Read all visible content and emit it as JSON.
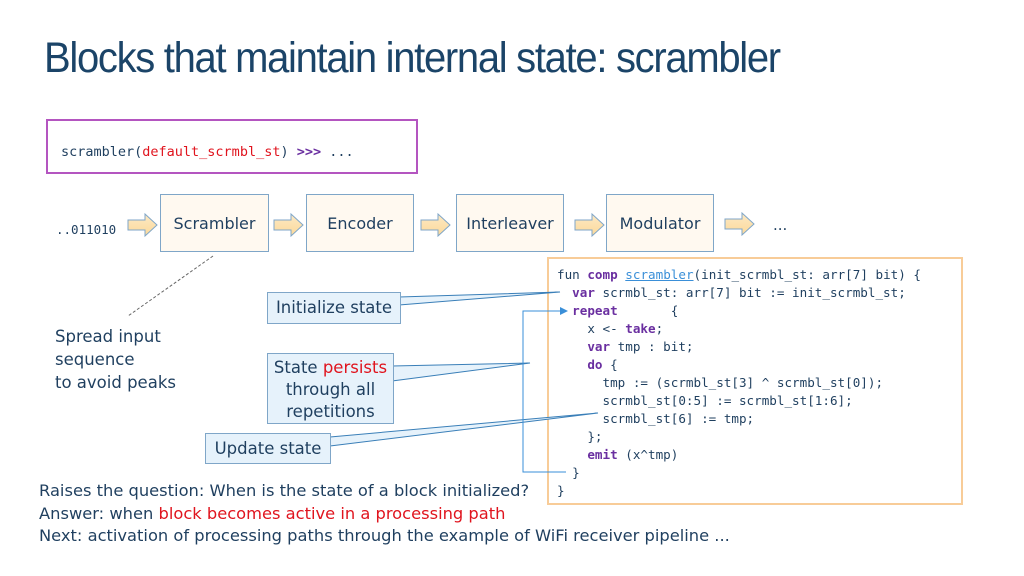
{
  "title": "Blocks that maintain internal state: scrambler",
  "usage_snippet": {
    "prefix": "scrambler(",
    "argument": "default_scrmbl_st",
    "suffix": ")",
    "operator": ">>>",
    "tail": "..."
  },
  "pipeline": {
    "input_bits": "..011010",
    "blocks": [
      "Scrambler",
      "Encoder",
      "Interleaver",
      "Modulator"
    ],
    "trailing": "...",
    "arrow_icon": "block-arrow-right"
  },
  "spread_note": [
    "Spread input",
    "sequence",
    "to avoid peaks"
  ],
  "annotations": {
    "initialize": "Initialize state",
    "persists_prefix": "State ",
    "persists_highlight": "persists",
    "persists_line2": "through all",
    "persists_line3": "repetitions",
    "update": "Update state"
  },
  "code": {
    "l1_kw1": "fun",
    "l1_kw2": "comp",
    "l1_name": "scrambler",
    "l1_rest": "(init_scrmbl_st: arr[7] bit) {",
    "l2_kw": "var",
    "l2_rest": " scrmbl_st: arr[7] bit := init_scrmbl_st;",
    "l3_kw": "repeat",
    "l3_rest": "       {",
    "l4_a": "x <- ",
    "l4_kw": "take",
    "l4_b": ";",
    "l5_kw": "var",
    "l5_rest": " tmp : bit;",
    "l6_kw": "do",
    "l6_rest": " {",
    "l7": "tmp := (scrmbl_st[3] ^ scrmbl_st[0]);",
    "l8": "scrmbl_st[0:5] := scrmbl_st[1:6];",
    "l9": "scrmbl_st[6] := tmp;",
    "l10": "};",
    "l11_kw": "emit",
    "l11_rest": " (x^tmp)",
    "l12": "}",
    "l13": "}"
  },
  "bottom_text": {
    "line1": "Raises the question: When is the state of a block initialized?",
    "line2_prefix": "Answer: when ",
    "line2_highlight": "block becomes active in a processing path",
    "line3": "Next: activation of processing paths through the example of WiFi receiver pipeline ..."
  },
  "colors": {
    "title": "#1b4468",
    "text": "#1f3f5f",
    "highlight_red": "#e0141e",
    "keyword_purple": "#6a2fa0",
    "link_blue": "#3a8fd8",
    "snippet_border": "#b455c0",
    "code_border": "#f8cc98",
    "block_border": "#7fa6c8",
    "block_fill": "#fff9f0",
    "note_fill": "#e6f2fb",
    "connector": "#3a7fb8"
  }
}
